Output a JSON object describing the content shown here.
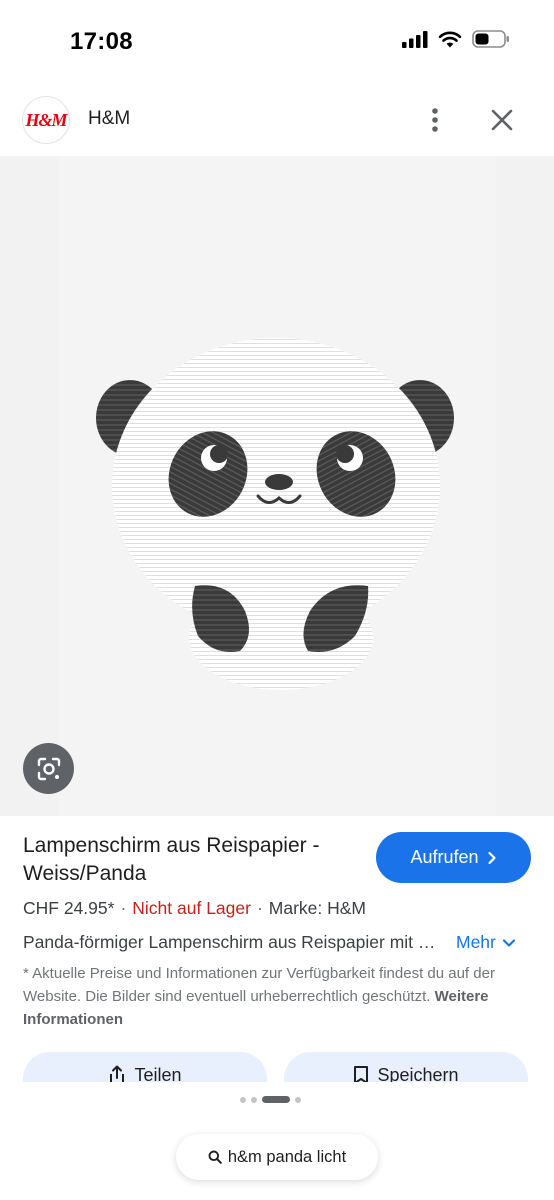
{
  "status_bar": {
    "time": "17:08",
    "icons": [
      "signal-icon",
      "wifi-icon",
      "battery-icon"
    ]
  },
  "header": {
    "logo_text": "H&M",
    "site_name": "H&M",
    "icons": [
      "more-vert-icon",
      "close-icon"
    ]
  },
  "image": {
    "alt": "Lampenschirm aus Reispapier - Weiss/Panda",
    "lens_icon": "google-lens-icon"
  },
  "product": {
    "title": "Lampenschirm aus Reispapier - Weiss/Panda",
    "visit_button": "Aufrufen",
    "price": "CHF 24.95*",
    "stock_status": "Nicht auf Lager",
    "separator": "·",
    "brand": "Marke: H&M",
    "description": "Panda-förmiger Lampenschirm aus Reispapier mit Metallgestell",
    "more_label": "Mehr",
    "disclaimer": "* Aktuelle Preise und Informationen zur Verfügbarkeit findest du auf der Website. Die Bilder sind eventuell urheberrechtlich geschützt.",
    "disclaimer_link": "Weitere Informationen"
  },
  "actions": {
    "share_label": "Teilen",
    "save_label": "Speichern"
  },
  "carousel": {
    "dot_count": 4,
    "active_index": 2
  },
  "search": {
    "query": "h&m panda licht"
  },
  "colors": {
    "accent_blue": "#1a73e8",
    "out_of_stock_red": "#c5221f",
    "brand_red": "#e50010"
  }
}
